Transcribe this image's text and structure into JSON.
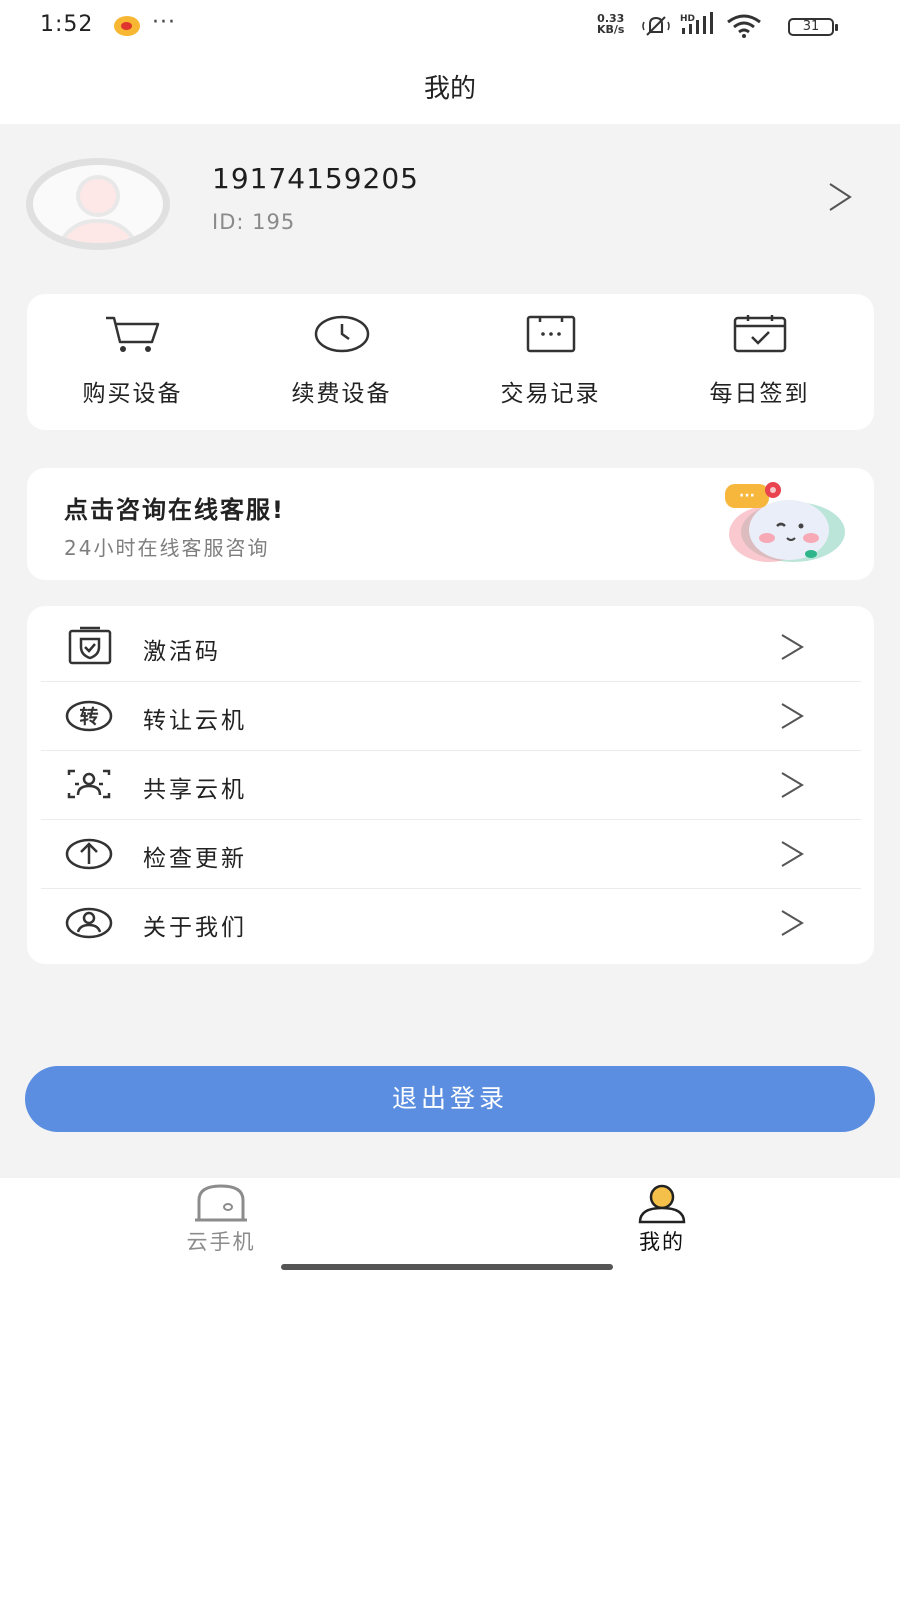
{
  "status_bar": {
    "time": "1:52",
    "more": "···",
    "net_speed_value": "0.33",
    "net_speed_unit": "KB/s",
    "battery": "31"
  },
  "header": {
    "title": "我的"
  },
  "profile": {
    "phone": "19174159205",
    "id_text": "ID: 195"
  },
  "quick_actions": [
    {
      "label": "购买设备",
      "icon": "cart-icon"
    },
    {
      "label": "续费设备",
      "icon": "clock-icon"
    },
    {
      "label": "交易记录",
      "icon": "receipt-icon"
    },
    {
      "label": "每日签到",
      "icon": "calendar-check-icon"
    }
  ],
  "service": {
    "title": "点击咨询在线客服!",
    "subtitle": "24小时在线客服咨询",
    "bubble": "···"
  },
  "menu": [
    {
      "label": "激活码",
      "icon": "shield-card-icon"
    },
    {
      "label": "转让云机",
      "icon": "transfer-icon",
      "icon_text": "转"
    },
    {
      "label": "共享云机",
      "icon": "share-icon"
    },
    {
      "label": "检查更新",
      "icon": "upload-arrow-icon"
    },
    {
      "label": "关于我们",
      "icon": "user-circle-icon"
    }
  ],
  "logout_label": "退出登录",
  "tabs": [
    {
      "label": "云手机",
      "active": false
    },
    {
      "label": "我的",
      "active": true
    }
  ],
  "colors": {
    "accent": "#5b8ee0",
    "page_bg": "#f3f3f3",
    "active_tab_icon": "#f5c04a"
  }
}
